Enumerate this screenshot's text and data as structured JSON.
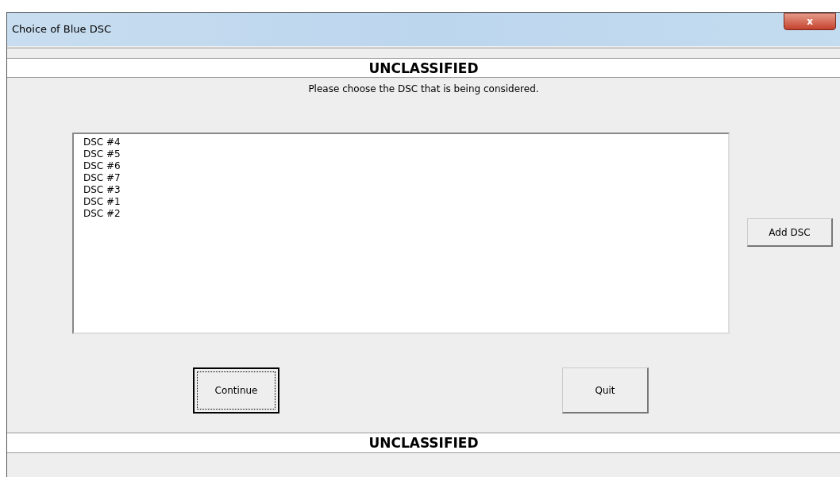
{
  "window": {
    "title": "Choice of Blue DSC",
    "close": "x"
  },
  "top_banner": "UNCLASSIFIED",
  "instruction": "Please choose the DSC that is being considered.",
  "list": {
    "items": [
      "DSC #4",
      "DSC #5",
      "DSC #6",
      "DSC #7",
      "DSC #3",
      "DSC #1",
      "DSC #2"
    ]
  },
  "side_button": {
    "label": "Add DSC",
    "focused": false
  },
  "buttons": [
    {
      "label": "Continue",
      "focused": true
    },
    {
      "label": "Quit",
      "focused": false
    }
  ],
  "bottom_banner": "UNCLASSIFIED"
}
